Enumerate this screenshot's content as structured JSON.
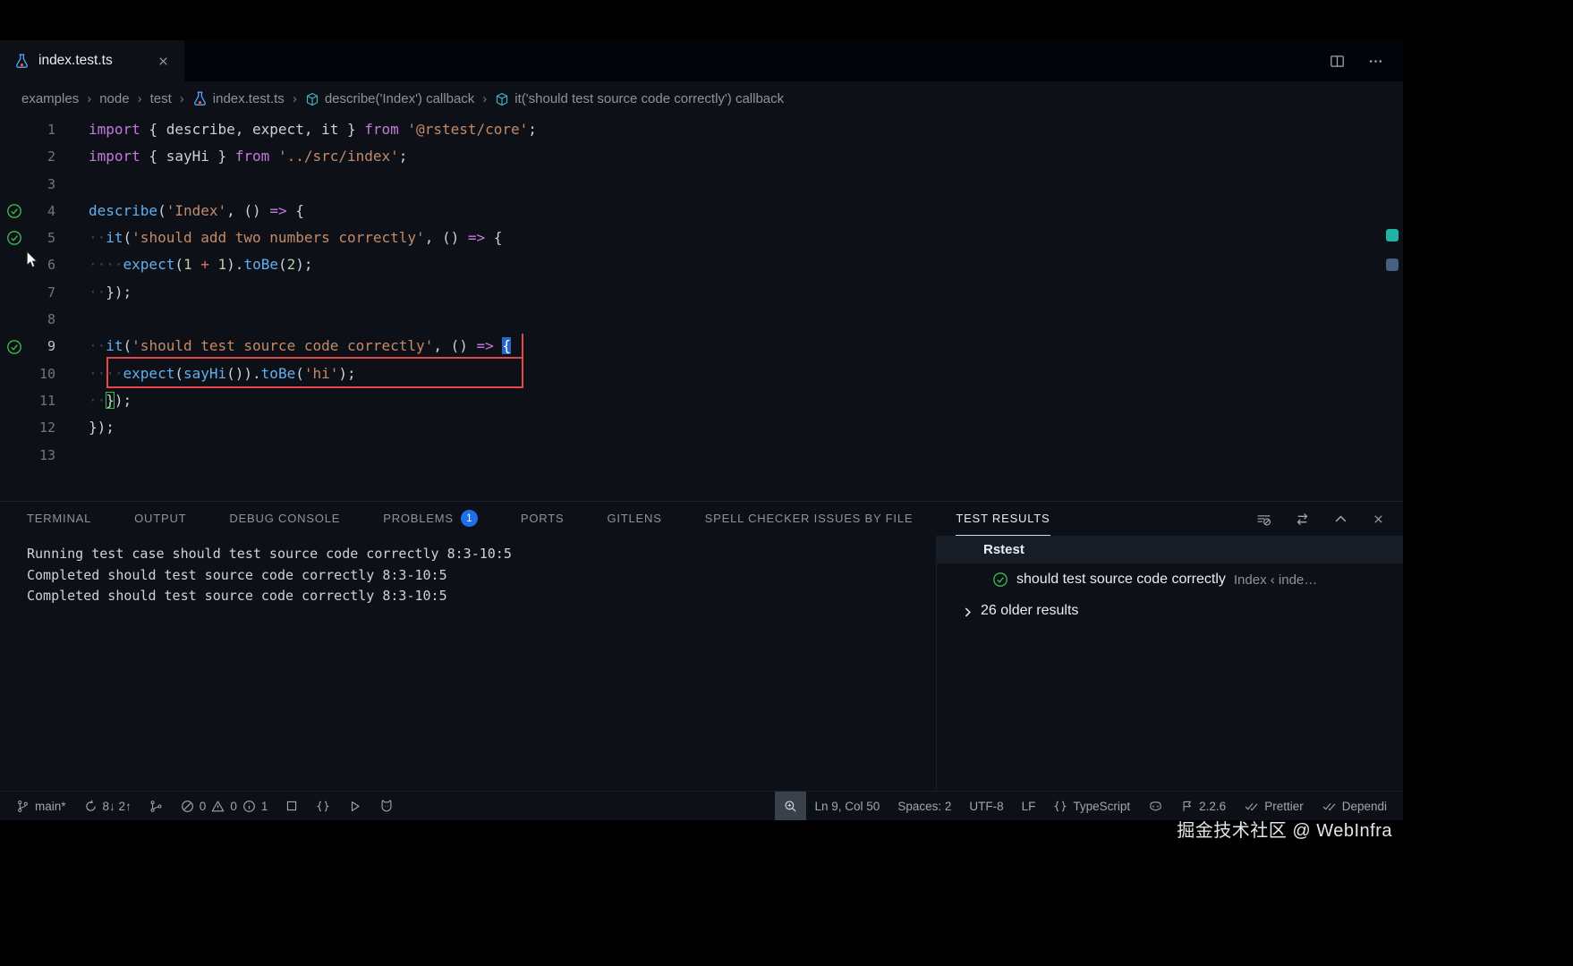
{
  "window": {
    "watermark": "掘金技术社区 @ WebInfra"
  },
  "tab": {
    "title": "index.test.ts"
  },
  "breadcrumbs": [
    {
      "label": "examples"
    },
    {
      "label": "node"
    },
    {
      "label": "test"
    },
    {
      "label": "index.test.ts",
      "icon": "flask"
    },
    {
      "label": "describe('Index') callback",
      "icon": "cube"
    },
    {
      "label": "it('should test source code correctly') callback",
      "icon": "cube"
    }
  ],
  "editor": {
    "gutter_checks": [
      4,
      5,
      9
    ],
    "cursor_line": 9,
    "lines": [
      {
        "n": 1,
        "tokens": [
          [
            "kw",
            "import"
          ],
          [
            "pl",
            " { describe, expect, it } "
          ],
          [
            "kw",
            "from"
          ],
          [
            "pl",
            " "
          ],
          [
            "str",
            "'@rstest/core'"
          ],
          [
            "pl",
            ";"
          ]
        ]
      },
      {
        "n": 2,
        "tokens": [
          [
            "kw",
            "import"
          ],
          [
            "pl",
            " { sayHi } "
          ],
          [
            "kw",
            "from"
          ],
          [
            "pl",
            " "
          ],
          [
            "str",
            "'../src/index'"
          ],
          [
            "pl",
            ";"
          ]
        ]
      },
      {
        "n": 3,
        "tokens": []
      },
      {
        "n": 4,
        "tokens": [
          [
            "fn",
            "describe"
          ],
          [
            "pl",
            "("
          ],
          [
            "str",
            "'Index'"
          ],
          [
            "pl",
            ", () "
          ],
          [
            "op",
            "=>"
          ],
          [
            "pl",
            " {"
          ]
        ]
      },
      {
        "n": 5,
        "tokens": [
          [
            "ws",
            "··"
          ],
          [
            "fn",
            "it"
          ],
          [
            "pl",
            "("
          ],
          [
            "str",
            "'should add two numbers correctly'"
          ],
          [
            "pl",
            ", () "
          ],
          [
            "op",
            "=>"
          ],
          [
            "pl",
            " {"
          ]
        ]
      },
      {
        "n": 6,
        "tokens": [
          [
            "ws",
            "····"
          ],
          [
            "fn",
            "expect"
          ],
          [
            "pl",
            "("
          ],
          [
            "num",
            "1"
          ],
          [
            "pl",
            " "
          ],
          [
            "opr",
            "+"
          ],
          [
            "pl",
            " "
          ],
          [
            "num",
            "1"
          ],
          [
            "pl",
            ")."
          ],
          [
            "fn",
            "toBe"
          ],
          [
            "pl",
            "("
          ],
          [
            "num",
            "2"
          ],
          [
            "pl",
            ");"
          ]
        ]
      },
      {
        "n": 7,
        "tokens": [
          [
            "ws",
            "··"
          ],
          [
            "pl",
            "});"
          ]
        ]
      },
      {
        "n": 8,
        "tokens": []
      },
      {
        "n": 9,
        "active": true,
        "tokens": [
          [
            "ws",
            "··"
          ],
          [
            "fn",
            "it"
          ],
          [
            "pl",
            "("
          ],
          [
            "str",
            "'should test source code correctly'"
          ],
          [
            "pl",
            ", () "
          ],
          [
            "op",
            "=>"
          ],
          [
            "pl",
            " "
          ],
          [
            "cursor",
            "{"
          ]
        ]
      },
      {
        "n": 10,
        "tokens": [
          [
            "ws",
            "····"
          ],
          [
            "fn",
            "expect"
          ],
          [
            "pl",
            "("
          ],
          [
            "fn",
            "sayHi"
          ],
          [
            "pl",
            "())."
          ],
          [
            "fn",
            "toBe"
          ],
          [
            "pl",
            "("
          ],
          [
            "str",
            "'hi'"
          ],
          [
            "pl",
            ");"
          ]
        ]
      },
      {
        "n": 11,
        "tokens": [
          [
            "ws",
            "··"
          ],
          [
            "bm",
            "}"
          ],
          [
            "pl",
            ");"
          ]
        ]
      },
      {
        "n": 12,
        "tokens": [
          [
            "pl",
            "});"
          ]
        ]
      },
      {
        "n": 13,
        "tokens": []
      }
    ]
  },
  "panel": {
    "tabs": [
      {
        "label": "TERMINAL"
      },
      {
        "label": "OUTPUT"
      },
      {
        "label": "DEBUG CONSOLE"
      },
      {
        "label": "PROBLEMS",
        "badge": "1"
      },
      {
        "label": "PORTS"
      },
      {
        "label": "GITLENS"
      },
      {
        "label": "SPELL CHECKER ISSUES BY FILE"
      },
      {
        "label": "TEST RESULTS",
        "active": true
      }
    ],
    "actions": [
      "filter",
      "swap",
      "maximize",
      "close"
    ],
    "terminal_lines": [
      "Running test case should test source code correctly 8:3-10:5",
      "Completed should test source code correctly 8:3-10:5",
      "Completed should test source code correctly 8:3-10:5"
    ],
    "results": {
      "header": "Rstest",
      "test": {
        "name": "should test source code correctly",
        "location": "Index ‹ inde…"
      },
      "older": "26 older results"
    }
  },
  "statusbar": {
    "left": [
      {
        "name": "branch",
        "parts": [
          {
            "i": "branch"
          },
          {
            "t": "main*"
          }
        ]
      },
      {
        "name": "sync",
        "parts": [
          {
            "i": "sync"
          },
          {
            "t": "8↓ 2↑"
          }
        ]
      },
      {
        "name": "git-graph",
        "parts": [
          {
            "i": "graph"
          }
        ]
      },
      {
        "name": "problems",
        "parts": [
          {
            "i": "error"
          },
          {
            "t": "0"
          },
          {
            "i": "warning"
          },
          {
            "t": "0"
          },
          {
            "i": "info"
          },
          {
            "t": "1"
          }
        ]
      },
      {
        "name": "stop",
        "parts": [
          {
            "i": "stop"
          }
        ]
      },
      {
        "name": "brackets",
        "parts": [
          {
            "i": "braces"
          }
        ]
      },
      {
        "name": "run-task",
        "parts": [
          {
            "i": "play"
          }
        ]
      },
      {
        "name": "pet",
        "parts": [
          {
            "i": "cat"
          }
        ]
      }
    ],
    "right": [
      {
        "name": "zoom",
        "highlight": true,
        "parts": [
          {
            "i": "search"
          }
        ]
      },
      {
        "name": "cursor-position",
        "parts": [
          {
            "t": "Ln 9, Col 50"
          }
        ]
      },
      {
        "name": "indentation",
        "parts": [
          {
            "t": "Spaces: 2"
          }
        ]
      },
      {
        "name": "encoding",
        "parts": [
          {
            "t": "UTF-8"
          }
        ]
      },
      {
        "name": "eol",
        "parts": [
          {
            "t": "LF"
          }
        ]
      },
      {
        "name": "language-mode",
        "parts": [
          {
            "i": "braces"
          },
          {
            "t": "TypeScript"
          }
        ]
      },
      {
        "name": "copilot",
        "parts": [
          {
            "i": "copilot"
          }
        ]
      },
      {
        "name": "version",
        "parts": [
          {
            "i": "flag"
          },
          {
            "t": "2.2.6"
          }
        ]
      },
      {
        "name": "prettier",
        "parts": [
          {
            "i": "check-all"
          },
          {
            "t": "Prettier"
          }
        ]
      },
      {
        "name": "dependi",
        "parts": [
          {
            "i": "check-all"
          },
          {
            "t": "Dependi"
          }
        ]
      }
    ]
  }
}
